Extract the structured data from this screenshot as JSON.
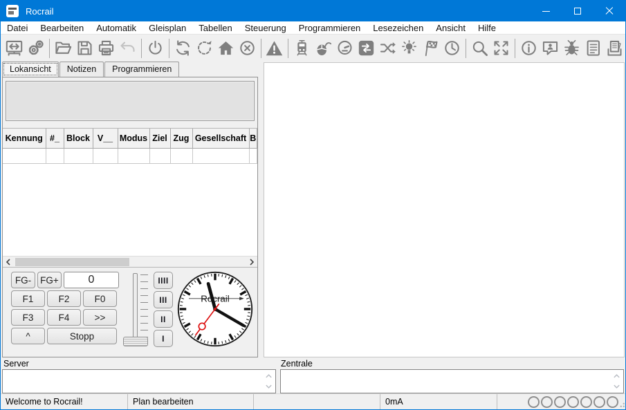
{
  "window": {
    "title": "Rocrail"
  },
  "colors": {
    "titlebar": "#0078d7",
    "toolbar_icon": "#7f7f7f",
    "second_hand": "#dd1111"
  },
  "menu": {
    "items": [
      "Datei",
      "Bearbeiten",
      "Automatik",
      "Gleisplan",
      "Tabellen",
      "Steuerung",
      "Programmieren",
      "Lesezeichen",
      "Ansicht",
      "Hilfe"
    ]
  },
  "toolbar": {
    "icons": [
      "workspace-icon",
      "properties-icon",
      "open-icon",
      "save-icon",
      "print-icon",
      "undo-icon",
      "power-icon",
      "refresh-icon",
      "reset-icon",
      "home-icon",
      "cancel-icon",
      "alert-icon",
      "loco-icon",
      "mouse-icon",
      "gauge-icon",
      "routes-icon",
      "shuffle-icon",
      "lamp-icon",
      "finish-flag-icon",
      "fast-clock-icon",
      "search-icon",
      "fullscreen-icon",
      "info-icon",
      "support-icon",
      "debug-icon",
      "log-icon",
      "pages-icon"
    ]
  },
  "tabs": [
    "Lokansicht",
    "Notizen",
    "Programmieren"
  ],
  "loco_table": {
    "columns": [
      "Kennung",
      "#_",
      "Block",
      "V__",
      "Modus",
      "Ziel",
      "Zug",
      "Gesellschaft",
      "B"
    ],
    "rows": [
      [
        "",
        "",
        "",
        "",
        "",
        "",
        "",
        "",
        ""
      ]
    ]
  },
  "throttle": {
    "fg_minus": "FG-",
    "fg_plus": "FG+",
    "speed": "0",
    "f1": "F1",
    "f2": "F2",
    "f0": "F0",
    "f3": "F3",
    "f4": "F4",
    "more": ">>",
    "dir_up": "^",
    "stop": "Stopp",
    "steps": [
      "IIII",
      "III",
      "II",
      "I"
    ]
  },
  "clock": {
    "brand": "Rocrail"
  },
  "panels": {
    "server_label": "Server",
    "server_value": "",
    "zentrale_label": "Zentrale",
    "zentrale_value": ""
  },
  "statusbar": {
    "message": "Welcome to Rocrail!",
    "mode": "Plan bearbeiten",
    "current": "0mA",
    "led_count": 7
  }
}
